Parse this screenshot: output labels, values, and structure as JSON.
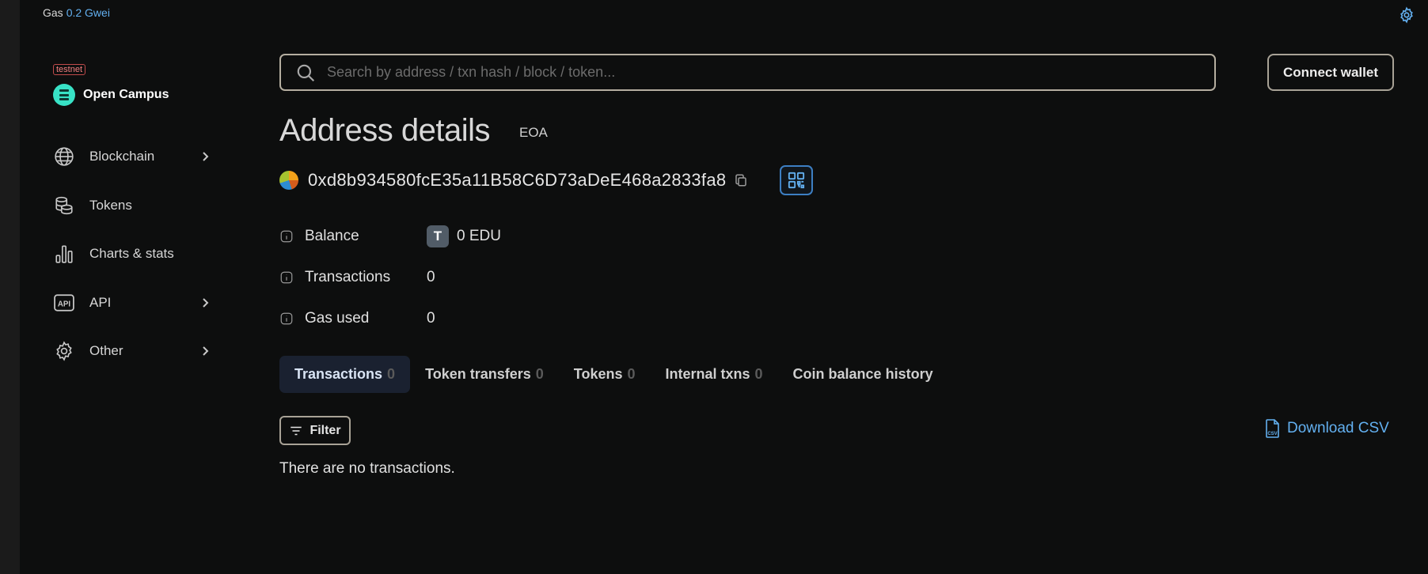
{
  "topbar": {
    "gas_label": "Gas",
    "gas_value": "0.2 Gwei"
  },
  "brand": {
    "badge": "testnet",
    "name": "Open Campus"
  },
  "sidebar": {
    "items": [
      {
        "label": "Blockchain",
        "icon": "globe-icon",
        "has_submenu": true
      },
      {
        "label": "Tokens",
        "icon": "coins-icon",
        "has_submenu": false
      },
      {
        "label": "Charts & stats",
        "icon": "bar-chart-icon",
        "has_submenu": false
      },
      {
        "label": "API",
        "icon": "api-icon",
        "has_submenu": true
      },
      {
        "label": "Other",
        "icon": "gear-icon",
        "has_submenu": true
      }
    ]
  },
  "search": {
    "placeholder": "Search by address / txn hash / block / token...",
    "value": ""
  },
  "header": {
    "connect_wallet_label": "Connect wallet"
  },
  "address": {
    "title": "Address details",
    "type_badge": "EOA",
    "hash": "0xd8b934580fcE35a11B58C6D73aDeE468a2833fa8"
  },
  "details": {
    "balance_label": "Balance",
    "balance_token_letter": "T",
    "balance_value": "0 EDU",
    "transactions_label": "Transactions",
    "transactions_value": "0",
    "gas_used_label": "Gas used",
    "gas_used_value": "0"
  },
  "tabs": [
    {
      "label": "Transactions",
      "count": "0",
      "active": true
    },
    {
      "label": "Token transfers",
      "count": "0",
      "active": false
    },
    {
      "label": "Tokens",
      "count": "0",
      "active": false
    },
    {
      "label": "Internal txns",
      "count": "0",
      "active": false
    },
    {
      "label": "Coin balance history",
      "count": "",
      "active": false
    }
  ],
  "toolbar": {
    "filter_label": "Filter",
    "download_label": "Download CSV",
    "csv_icon_text": "CSV"
  },
  "empty_state": "There are no transactions.",
  "colors": {
    "accent": "#63b0f0",
    "brand": "#38e2c6",
    "testnet": "#c14b4b",
    "background": "#0d0e0e"
  }
}
